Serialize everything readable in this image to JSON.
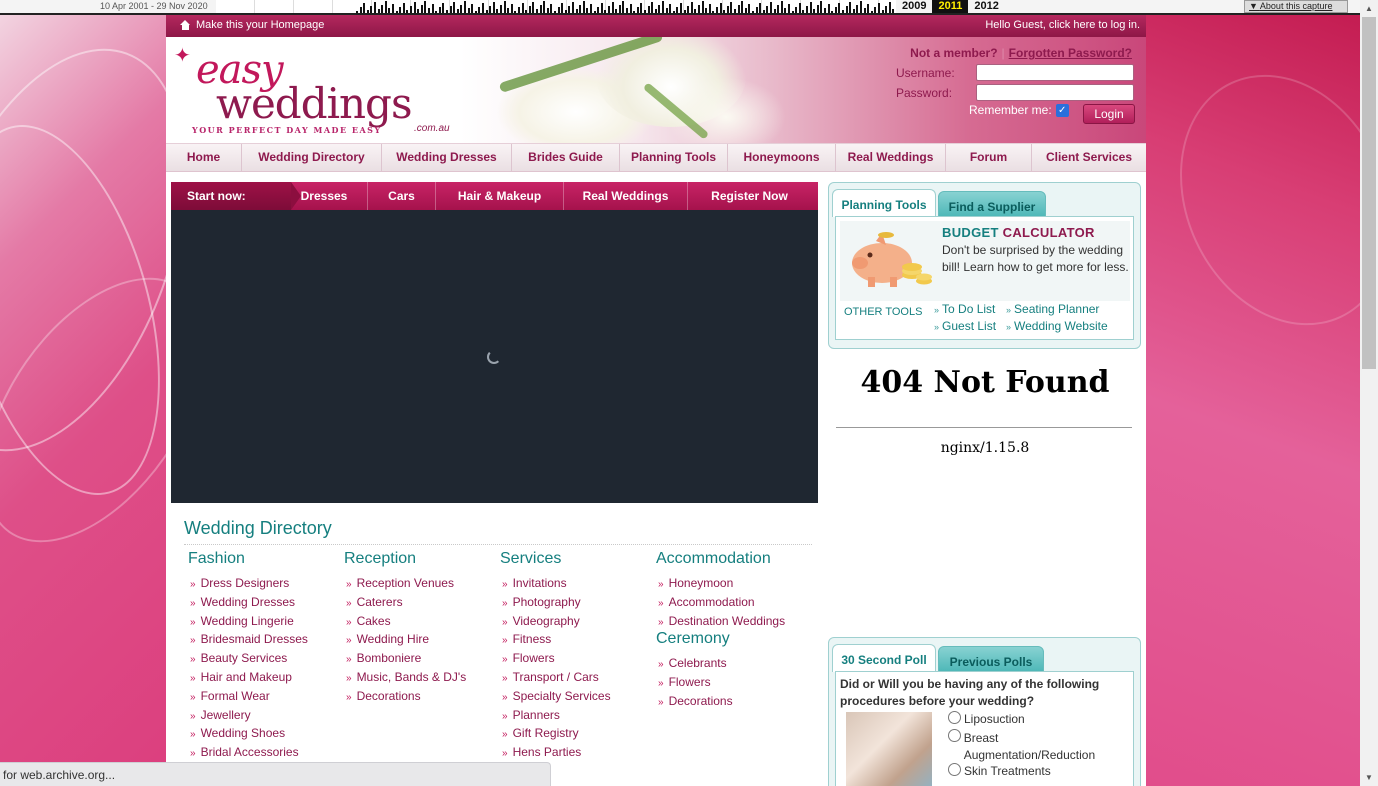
{
  "wayback": {
    "range": "10 Apr 2001 - 29 Nov 2020",
    "years": [
      "2009",
      "2011",
      "2012"
    ],
    "active_year": "2011",
    "about_label": "About this capture"
  },
  "topstrip": {
    "homepage_label": "Make this your Homepage",
    "greeting": "Hello Guest, click here to log in."
  },
  "logo": {
    "easy": "easy",
    "weddings": "weddings",
    "tagline": "YOUR PERFECT DAY MADE EASY",
    "domain": ".com.au"
  },
  "login": {
    "not_member": "Not a member?",
    "forgotten": "Forgotten Password?",
    "username_label": "Username:",
    "password_label": "Password:",
    "remember_label": "Remember me:",
    "remember_checked": true,
    "login_button": "Login"
  },
  "mainnav": [
    "Home",
    "Wedding Directory",
    "Wedding Dresses",
    "Brides Guide",
    "Planning Tools",
    "Honeymoons",
    "Real Weddings",
    "Forum",
    "Client Services"
  ],
  "startbar": {
    "lead": "Start now:",
    "links": [
      "Dresses",
      "Cars",
      "Hair & Makeup",
      "Real Weddings",
      "Register Now"
    ]
  },
  "directory": {
    "title": "Wedding Directory",
    "columns": [
      {
        "head": "Fashion",
        "items": [
          "Dress Designers",
          "Wedding Dresses",
          "Wedding Lingerie",
          "Bridesmaid Dresses",
          "Beauty Services",
          "Hair and Makeup",
          "Formal Wear",
          "Jewellery",
          "Wedding Shoes",
          "Bridal Accessories"
        ]
      },
      {
        "head": "Reception",
        "items": [
          "Reception Venues",
          "Caterers",
          "Cakes",
          "Wedding Hire",
          "Bomboniere",
          "Music, Bands & DJ's",
          "Decorations"
        ]
      },
      {
        "head": "Services",
        "items": [
          "Invitations",
          "Photography",
          "Videography",
          "Fitness",
          "Flowers",
          "Transport / Cars",
          "Specialty Services",
          "Planners",
          "Gift Registry",
          "Hens Parties"
        ]
      },
      {
        "head": "Accommodation",
        "items": [
          "Honeymoon",
          "Accommodation",
          "Destination Weddings"
        ]
      }
    ],
    "ceremony": {
      "head": "Ceremony",
      "items": [
        "Celebrants",
        "Flowers",
        "Decorations"
      ]
    }
  },
  "tools": {
    "tab_active": "Planning Tools",
    "tab_inactive": "Find a Supplier",
    "budget_word1": "BUDGET",
    "budget_word2": "CALCULATOR",
    "budget_desc": "Don't be surprised by the wedding bill! Learn how to get more for less.",
    "other_tools": "OTHER TOOLS",
    "links": [
      "To Do List",
      "Seating Planner",
      "Guest List",
      "Wedding Website"
    ]
  },
  "notfound": {
    "title": "404 Not Found",
    "server": "nginx/1.15.8"
  },
  "poll": {
    "tab_active": "30 Second Poll",
    "tab_inactive": "Previous Polls",
    "question": "Did or Will you be having any of the following procedures before your wedding?",
    "options": [
      "Liposuction",
      "Breast Augmentation/Reduction",
      "Skin Treatments"
    ]
  },
  "status": "for web.archive.org..."
}
